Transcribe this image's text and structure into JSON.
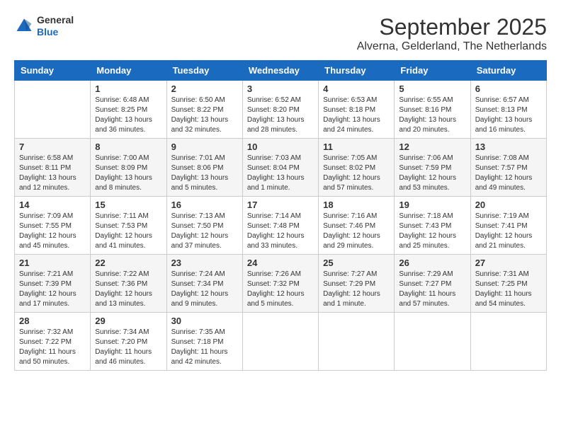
{
  "header": {
    "logo": {
      "general": "General",
      "blue": "Blue"
    },
    "title": "September 2025",
    "subtitle": "Alverna, Gelderland, The Netherlands"
  },
  "days_of_week": [
    "Sunday",
    "Monday",
    "Tuesday",
    "Wednesday",
    "Thursday",
    "Friday",
    "Saturday"
  ],
  "weeks": [
    {
      "days": [
        {
          "num": "",
          "info": ""
        },
        {
          "num": "1",
          "info": "Sunrise: 6:48 AM\nSunset: 8:25 PM\nDaylight: 13 hours\nand 36 minutes."
        },
        {
          "num": "2",
          "info": "Sunrise: 6:50 AM\nSunset: 8:22 PM\nDaylight: 13 hours\nand 32 minutes."
        },
        {
          "num": "3",
          "info": "Sunrise: 6:52 AM\nSunset: 8:20 PM\nDaylight: 13 hours\nand 28 minutes."
        },
        {
          "num": "4",
          "info": "Sunrise: 6:53 AM\nSunset: 8:18 PM\nDaylight: 13 hours\nand 24 minutes."
        },
        {
          "num": "5",
          "info": "Sunrise: 6:55 AM\nSunset: 8:16 PM\nDaylight: 13 hours\nand 20 minutes."
        },
        {
          "num": "6",
          "info": "Sunrise: 6:57 AM\nSunset: 8:13 PM\nDaylight: 13 hours\nand 16 minutes."
        }
      ]
    },
    {
      "days": [
        {
          "num": "7",
          "info": "Sunrise: 6:58 AM\nSunset: 8:11 PM\nDaylight: 13 hours\nand 12 minutes."
        },
        {
          "num": "8",
          "info": "Sunrise: 7:00 AM\nSunset: 8:09 PM\nDaylight: 13 hours\nand 8 minutes."
        },
        {
          "num": "9",
          "info": "Sunrise: 7:01 AM\nSunset: 8:06 PM\nDaylight: 13 hours\nand 5 minutes."
        },
        {
          "num": "10",
          "info": "Sunrise: 7:03 AM\nSunset: 8:04 PM\nDaylight: 13 hours\nand 1 minute."
        },
        {
          "num": "11",
          "info": "Sunrise: 7:05 AM\nSunset: 8:02 PM\nDaylight: 12 hours\nand 57 minutes."
        },
        {
          "num": "12",
          "info": "Sunrise: 7:06 AM\nSunset: 7:59 PM\nDaylight: 12 hours\nand 53 minutes."
        },
        {
          "num": "13",
          "info": "Sunrise: 7:08 AM\nSunset: 7:57 PM\nDaylight: 12 hours\nand 49 minutes."
        }
      ]
    },
    {
      "days": [
        {
          "num": "14",
          "info": "Sunrise: 7:09 AM\nSunset: 7:55 PM\nDaylight: 12 hours\nand 45 minutes."
        },
        {
          "num": "15",
          "info": "Sunrise: 7:11 AM\nSunset: 7:53 PM\nDaylight: 12 hours\nand 41 minutes."
        },
        {
          "num": "16",
          "info": "Sunrise: 7:13 AM\nSunset: 7:50 PM\nDaylight: 12 hours\nand 37 minutes."
        },
        {
          "num": "17",
          "info": "Sunrise: 7:14 AM\nSunset: 7:48 PM\nDaylight: 12 hours\nand 33 minutes."
        },
        {
          "num": "18",
          "info": "Sunrise: 7:16 AM\nSunset: 7:46 PM\nDaylight: 12 hours\nand 29 minutes."
        },
        {
          "num": "19",
          "info": "Sunrise: 7:18 AM\nSunset: 7:43 PM\nDaylight: 12 hours\nand 25 minutes."
        },
        {
          "num": "20",
          "info": "Sunrise: 7:19 AM\nSunset: 7:41 PM\nDaylight: 12 hours\nand 21 minutes."
        }
      ]
    },
    {
      "days": [
        {
          "num": "21",
          "info": "Sunrise: 7:21 AM\nSunset: 7:39 PM\nDaylight: 12 hours\nand 17 minutes."
        },
        {
          "num": "22",
          "info": "Sunrise: 7:22 AM\nSunset: 7:36 PM\nDaylight: 12 hours\nand 13 minutes."
        },
        {
          "num": "23",
          "info": "Sunrise: 7:24 AM\nSunset: 7:34 PM\nDaylight: 12 hours\nand 9 minutes."
        },
        {
          "num": "24",
          "info": "Sunrise: 7:26 AM\nSunset: 7:32 PM\nDaylight: 12 hours\nand 5 minutes."
        },
        {
          "num": "25",
          "info": "Sunrise: 7:27 AM\nSunset: 7:29 PM\nDaylight: 12 hours\nand 1 minute."
        },
        {
          "num": "26",
          "info": "Sunrise: 7:29 AM\nSunset: 7:27 PM\nDaylight: 11 hours\nand 57 minutes."
        },
        {
          "num": "27",
          "info": "Sunrise: 7:31 AM\nSunset: 7:25 PM\nDaylight: 11 hours\nand 54 minutes."
        }
      ]
    },
    {
      "days": [
        {
          "num": "28",
          "info": "Sunrise: 7:32 AM\nSunset: 7:22 PM\nDaylight: 11 hours\nand 50 minutes."
        },
        {
          "num": "29",
          "info": "Sunrise: 7:34 AM\nSunset: 7:20 PM\nDaylight: 11 hours\nand 46 minutes."
        },
        {
          "num": "30",
          "info": "Sunrise: 7:35 AM\nSunset: 7:18 PM\nDaylight: 11 hours\nand 42 minutes."
        },
        {
          "num": "",
          "info": ""
        },
        {
          "num": "",
          "info": ""
        },
        {
          "num": "",
          "info": ""
        },
        {
          "num": "",
          "info": ""
        }
      ]
    }
  ]
}
